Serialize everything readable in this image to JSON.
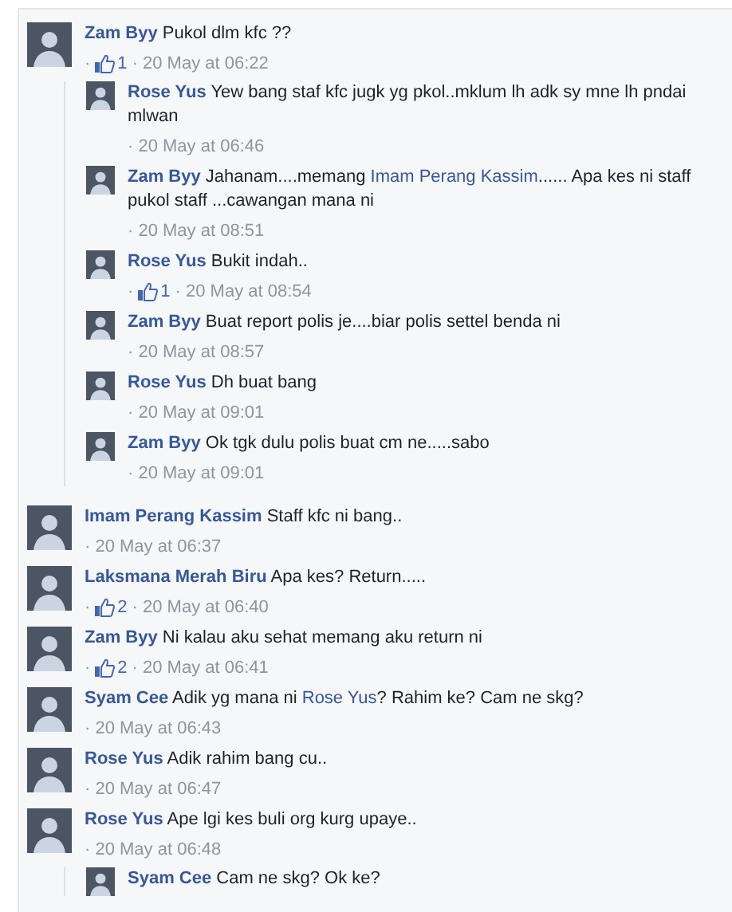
{
  "comments": [
    {
      "author": "Zam Byy",
      "text": [
        {
          "kind": "plain",
          "text": "Pukol dlm kfc ??"
        }
      ],
      "lead": "·",
      "likes": "1",
      "time": "· 20 May at 06:22",
      "replies": [
        {
          "author": "Rose Yus",
          "text": [
            {
              "kind": "plain",
              "text": "Yew bang staf kfc jugk yg pkol..mklum lh adk sy mne lh pndai mlwan"
            }
          ],
          "time": "· 20 May at 06:46"
        },
        {
          "author": "Zam Byy",
          "text": [
            {
              "kind": "plain",
              "text": "Jahanam....memang "
            },
            {
              "kind": "mention",
              "text": "Imam Perang Kassim"
            },
            {
              "kind": "plain",
              "text": "...... Apa kes ni staff pukol staff ...cawangan mana ni"
            }
          ],
          "time": "· 20 May at 08:51"
        },
        {
          "author": "Rose Yus",
          "text": [
            {
              "kind": "plain",
              "text": "Bukit indah.."
            }
          ],
          "lead": "·",
          "likes": "1",
          "time": "· 20 May at 08:54"
        },
        {
          "author": "Zam Byy",
          "text": [
            {
              "kind": "plain",
              "text": "Buat report polis je....biar polis settel benda ni"
            }
          ],
          "time": "· 20 May at 08:57"
        },
        {
          "author": "Rose Yus",
          "text": [
            {
              "kind": "plain",
              "text": "Dh buat bang"
            }
          ],
          "time": "· 20 May at 09:01"
        },
        {
          "author": "Zam Byy",
          "text": [
            {
              "kind": "plain",
              "text": "Ok tgk dulu polis buat cm ne.....sabo"
            }
          ],
          "time": "· 20 May at 09:01"
        }
      ]
    },
    {
      "author": "Imam Perang Kassim",
      "text": [
        {
          "kind": "plain",
          "text": "Staff kfc ni bang.."
        }
      ],
      "time": "· 20 May at 06:37"
    },
    {
      "author": "Laksmana Merah Biru",
      "text": [
        {
          "kind": "plain",
          "text": "Apa kes? Return....."
        }
      ],
      "lead": "·",
      "likes": "2",
      "time": "· 20 May at 06:40"
    },
    {
      "author": "Zam Byy",
      "text": [
        {
          "kind": "plain",
          "text": "Ni kalau aku sehat memang aku return ni"
        }
      ],
      "lead": "·",
      "likes": "2",
      "time": "· 20 May at 06:41"
    },
    {
      "author": "Syam Cee",
      "text": [
        {
          "kind": "plain",
          "text": "Adik yg mana ni "
        },
        {
          "kind": "mention",
          "text": "Rose Yus"
        },
        {
          "kind": "plain",
          "text": "? Rahim ke? Cam ne skg?"
        }
      ],
      "time": "· 20 May at 06:43"
    },
    {
      "author": "Rose Yus",
      "text": [
        {
          "kind": "plain",
          "text": "Adik rahim bang cu.."
        }
      ],
      "time": "· 20 May at 06:47"
    },
    {
      "author": "Rose Yus",
      "text": [
        {
          "kind": "plain",
          "text": "Ape lgi kes buli org kurg upaye.."
        }
      ],
      "time": "· 20 May at 06:48",
      "replies": [
        {
          "author": "Syam Cee",
          "text": [
            {
              "kind": "plain",
              "text": "Cam ne skg? Ok ke?"
            }
          ]
        }
      ]
    }
  ]
}
